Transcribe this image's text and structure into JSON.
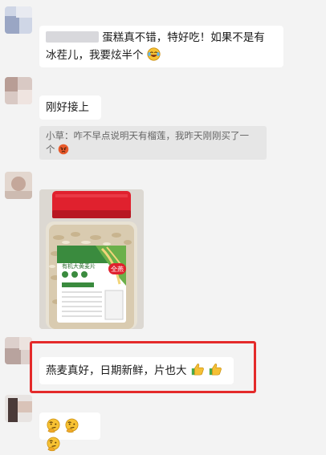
{
  "messages": {
    "m1": {
      "line1": "蛋糕真不错，特好吃！如果不是有",
      "line2": "冰茬儿，我要炫半个"
    },
    "m2": {
      "text": "刚好接上"
    },
    "m2_quote": {
      "line1": "小草：咋不早点说明天有榴莲，我昨天刚刚买了一",
      "line2": "个"
    },
    "m3_image": {
      "product_text": "有机大黄麦片",
      "badge_text": "全燕"
    },
    "m4": {
      "text": "燕麦真好，日期新鲜，片也大"
    },
    "m5": {
      "emoji_label": "thinking-face-emojis"
    }
  },
  "colors": {
    "chat_background": "#f3f3f3",
    "bubble": "#ffffff",
    "quote_background": "#e6e6e6",
    "highlight_border": "#e42a2a",
    "jar_lid": "#e0212e"
  },
  "icons": [
    "laughing-crying-emoji",
    "angry-emoji",
    "thumbs-up-emoji",
    "thinking-face-emoji"
  ]
}
